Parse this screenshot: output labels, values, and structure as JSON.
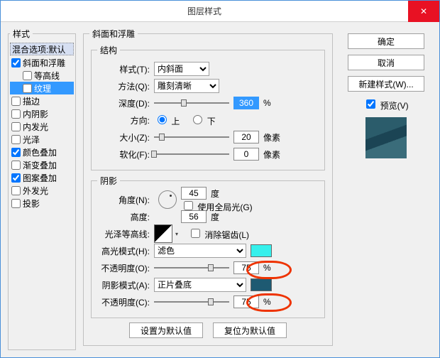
{
  "title": "图层样式",
  "close_icon": "✕",
  "styles_header": "样式",
  "blend_label": "混合选项:默认",
  "style_items": [
    {
      "label": "斜面和浮雕",
      "checked": true,
      "selected": false,
      "indent": false
    },
    {
      "label": "等高线",
      "checked": false,
      "selected": false,
      "indent": true
    },
    {
      "label": "纹理",
      "checked": false,
      "selected": true,
      "indent": true
    },
    {
      "label": "描边",
      "checked": false,
      "selected": false,
      "indent": false
    },
    {
      "label": "内阴影",
      "checked": false,
      "selected": false,
      "indent": false
    },
    {
      "label": "内发光",
      "checked": false,
      "selected": false,
      "indent": false
    },
    {
      "label": "光泽",
      "checked": false,
      "selected": false,
      "indent": false
    },
    {
      "label": "颜色叠加",
      "checked": true,
      "selected": false,
      "indent": false
    },
    {
      "label": "渐变叠加",
      "checked": false,
      "selected": false,
      "indent": false
    },
    {
      "label": "图案叠加",
      "checked": true,
      "selected": false,
      "indent": false
    },
    {
      "label": "外发光",
      "checked": false,
      "selected": false,
      "indent": false
    },
    {
      "label": "投影",
      "checked": false,
      "selected": false,
      "indent": false
    }
  ],
  "bevel": {
    "group_title": "斜面和浮雕",
    "structure_title": "结构",
    "style_label": "样式(T):",
    "style_value": "内斜面",
    "tech_label": "方法(Q):",
    "tech_value": "雕刻清晰",
    "depth_label": "深度(D):",
    "depth_value": "360",
    "pct": "%",
    "dir_label": "方向:",
    "dir_up": "上",
    "dir_down": "下",
    "size_label": "大小(Z):",
    "size_value": "20",
    "px": "像素",
    "soften_label": "软化(F):",
    "soften_value": "0"
  },
  "shading": {
    "group_title": "阴影",
    "angle_label": "角度(N):",
    "angle_value": "45",
    "deg": "度",
    "global_label": "使用全局光(G)",
    "alt_label": "高度:",
    "alt_value": "56",
    "gloss_label": "光泽等高线:",
    "anti_label": "消除锯齿(L)",
    "hl_mode_label": "高光模式(H):",
    "hl_mode_value": "滤色",
    "hl_color": "#36f0ec",
    "hl_op_label": "不透明度(O):",
    "hl_op_value": "75",
    "sh_mode_label": "阴影模式(A):",
    "sh_mode_value": "正片叠底",
    "sh_color": "#1e5a72",
    "sh_op_label": "不透明度(C):",
    "sh_op_value": "75"
  },
  "buttons": {
    "ok": "确定",
    "cancel": "取消",
    "new_style": "新建样式(W)...",
    "preview": "预览(V)",
    "make_default": "设置为默认值",
    "reset_default": "复位为默认值"
  }
}
